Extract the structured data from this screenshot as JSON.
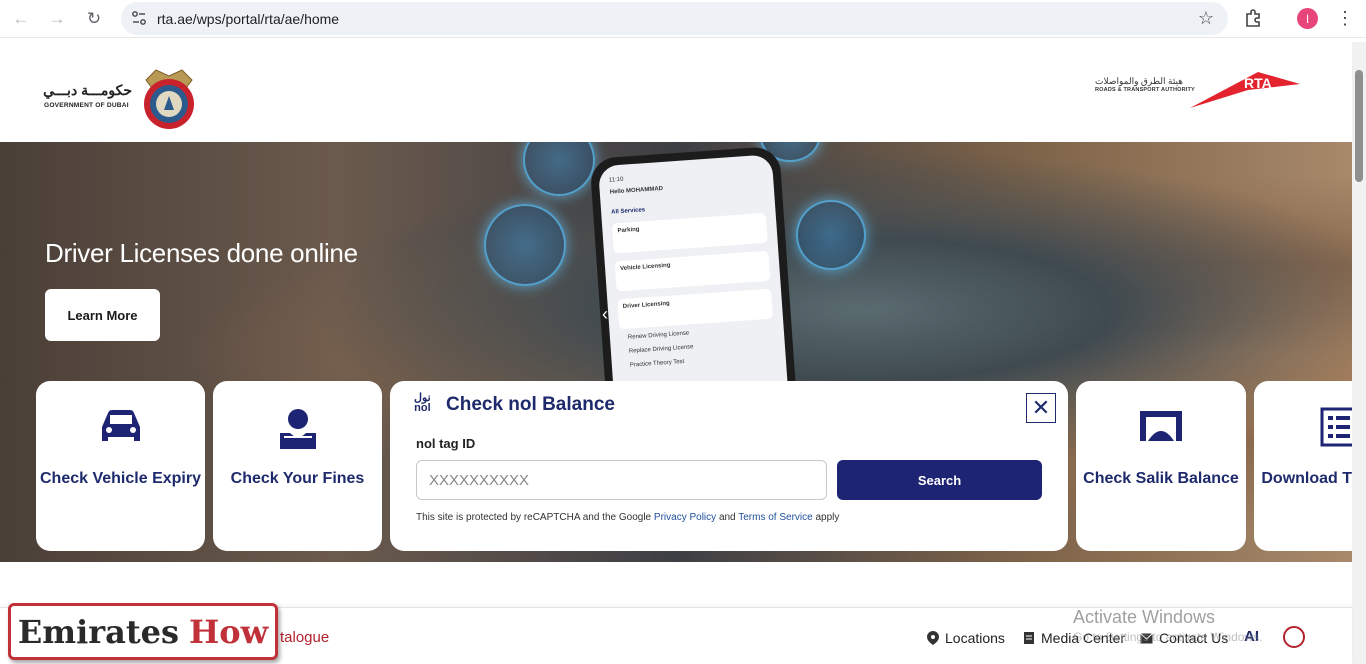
{
  "browser": {
    "url": "rta.ae/wps/portal/rta/ae/home",
    "profile_initial": "I"
  },
  "header": {
    "gov_logo_ar": "حكومـــة دبـــي",
    "gov_logo_en": "GOVERNMENT OF DUBAI",
    "rta_logo_ar": "هيئة الطرق والمواصلات",
    "rta_logo_en": "ROADS & TRANSPORT AUTHORITY",
    "rta_mark": "RTA"
  },
  "hero": {
    "title": "Driver Licenses done online",
    "button": "Learn More",
    "phone": {
      "time": "11:10",
      "greeting": "Hello MOHAMMAD",
      "section": "All Services",
      "items": [
        "Parking",
        "Vehicle Licensing",
        "Driver Licensing",
        "Renew Driving License",
        "Replace Driving License",
        "Practice Theory Test"
      ]
    }
  },
  "cards": [
    {
      "label": "Check Vehicle Expiry",
      "icon": "car-icon"
    },
    {
      "label": "Check Your Fines",
      "icon": "fines-icon"
    },
    {
      "label": "Check Salik Balance",
      "icon": "salik-gate-icon"
    },
    {
      "label": "Download Timetable",
      "icon": "timetable-icon"
    }
  ],
  "nol": {
    "logo_ar": "نول",
    "logo_en": "nol",
    "title": "Check nol Balance",
    "field_label": "nol tag ID",
    "placeholder": "XXXXXXXXXX",
    "search_label": "Search",
    "captcha_prefix": "This site is protected by reCAPTCHA and the Google",
    "privacy_link": "Privacy Policy",
    "captcha_and": "and",
    "terms_link": "Terms of Service",
    "captcha_suffix": "apply"
  },
  "bottom_bar": {
    "catalogue": "talogue",
    "locations": "Locations",
    "media_center": "Media Center",
    "contact_us": "Contact Us",
    "ai": "AI"
  },
  "overlay": {
    "activate_title": "Activate Windows",
    "activate_sub": "Go to Settings to activate Windows.",
    "watermark_part1": "Emirates",
    "watermark_part2": "How"
  }
}
